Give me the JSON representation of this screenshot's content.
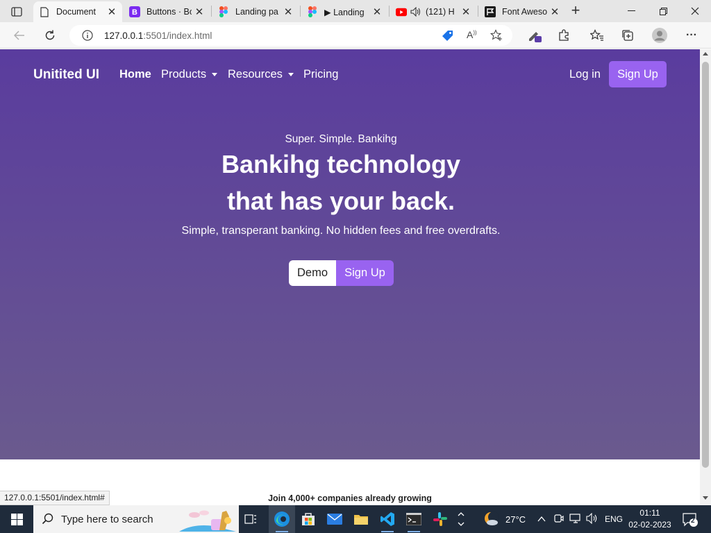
{
  "browser": {
    "tabs": [
      {
        "title": "Document",
        "favicon": "document-icon",
        "active": true
      },
      {
        "title": "Buttons · Bo",
        "favicon": "bootstrap-icon"
      },
      {
        "title": "Landing pa",
        "favicon": "figma-icon"
      },
      {
        "title": "▶ Landing",
        "favicon": "figma-icon"
      },
      {
        "title": "(121) H",
        "favicon": "youtube-icon"
      },
      {
        "title": "Font Aweso",
        "favicon": "fontawesome-icon"
      }
    ],
    "url_host": "127.0.0.1",
    "url_rest": ":5501/index.html",
    "status_url": "127.0.0.1:5501/index.html#"
  },
  "site": {
    "brand": "Unitited UI",
    "nav": [
      {
        "label": "Home",
        "active": true
      },
      {
        "label": "Products",
        "dropdown": true
      },
      {
        "label": "Resources",
        "dropdown": true
      },
      {
        "label": "Pricing"
      }
    ],
    "login_label": "Log in",
    "signup_label": "Sign Up",
    "hero": {
      "eyebrow": "Super. Simple. Bankihg",
      "headline_line1": "Bankihg technology",
      "headline_line2": "that has your back.",
      "subtitle": "Simple, transperant banking. No hidden fees and free overdrafts.",
      "demo_label": "Demo",
      "signup_label": "Sign Up"
    },
    "footer_teaser": "Join 4,000+ companies already growing"
  },
  "taskbar": {
    "search_placeholder": "Type here to search",
    "weather": "27°C",
    "language": "ENG",
    "time": "01:11",
    "date": "02-02-2023",
    "notifications": "2"
  },
  "colors": {
    "hero_top": "#5a3c9e",
    "hero_bottom": "#6a5a8e",
    "accent": "#9963f0"
  }
}
